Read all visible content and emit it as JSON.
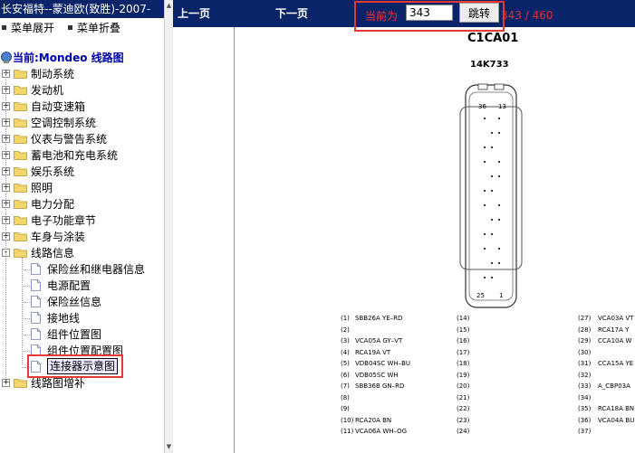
{
  "left_panel": {
    "title": "长安福特--蒙迪欧(致胜)-2007-",
    "expand_label": "菜单展开",
    "collapse_label": "菜单折叠",
    "current_label": "当前:Mondeo 线路图",
    "tree": [
      {
        "label": "制动系统",
        "type": "folder",
        "state": "+"
      },
      {
        "label": "发动机",
        "type": "folder",
        "state": "+"
      },
      {
        "label": "自动变速箱",
        "type": "folder",
        "state": "+"
      },
      {
        "label": "空调控制系统",
        "type": "folder",
        "state": "+"
      },
      {
        "label": "仪表与警告系统",
        "type": "folder",
        "state": "+"
      },
      {
        "label": "蓄电池和充电系统",
        "type": "folder",
        "state": "+"
      },
      {
        "label": "娱乐系统",
        "type": "folder",
        "state": "+"
      },
      {
        "label": "照明",
        "type": "folder",
        "state": "+"
      },
      {
        "label": "电力分配",
        "type": "folder",
        "state": "+"
      },
      {
        "label": "电子功能章节",
        "type": "folder",
        "state": "+"
      },
      {
        "label": "车身与涂装",
        "type": "folder",
        "state": "+"
      },
      {
        "label": "线路信息",
        "type": "folder",
        "state": "-"
      },
      {
        "label": "保险丝和继电器信息",
        "type": "doc"
      },
      {
        "label": "电源配置",
        "type": "doc"
      },
      {
        "label": "保险丝信息",
        "type": "doc"
      },
      {
        "label": "接地线",
        "type": "doc"
      },
      {
        "label": "组件位置图",
        "type": "doc"
      },
      {
        "label": "组件位置配置图",
        "type": "doc"
      },
      {
        "label": "连接器示意图",
        "type": "doc",
        "selected": true
      },
      {
        "label": "线路图增补",
        "type": "folder",
        "state": "+"
      }
    ]
  },
  "toolbar": {
    "prev_label": "上一页",
    "next_label": "下一页",
    "current_prefix": "当前为",
    "page_value": "343",
    "go_label": "跳转",
    "total_label": "343 / 460"
  },
  "document": {
    "connector_title": "C1CA01",
    "connector_id": "14K733",
    "pin_top_left": "36",
    "pin_top_right": "13",
    "pin_bottom_left": "25",
    "pin_bottom_right": "1",
    "col1": [
      {
        "n": "(1)",
        "w": "SBB26A YE–RD"
      },
      {
        "n": "(2)",
        "w": ""
      },
      {
        "n": "(3)",
        "w": "VCA05A GY–VT"
      },
      {
        "n": "(4)",
        "w": "RCA19A VT"
      },
      {
        "n": "(5)",
        "w": "VDB04SC WH–BU"
      },
      {
        "n": "(6)",
        "w": "VDB05SC WH"
      },
      {
        "n": "(7)",
        "w": "SBB36B GN–RD"
      },
      {
        "n": "(8)",
        "w": ""
      },
      {
        "n": "(9)",
        "w": ""
      },
      {
        "n": "(10)",
        "w": "RCA20A BN"
      },
      {
        "n": "(11)",
        "w": "VCA06A WH–OG"
      }
    ],
    "col2": [
      "(14)",
      "(15)",
      "(16)",
      "(17)",
      "(18)",
      "(19)",
      "(20)",
      "(21)",
      "(22)",
      "(23)",
      "(24)"
    ],
    "col3": [
      {
        "n": "(27)",
        "w": "VCA03A VT"
      },
      {
        "n": "(28)",
        "w": "RCA17A Y"
      },
      {
        "n": "(29)",
        "w": "CCA10A W"
      },
      {
        "n": "(30)",
        "w": ""
      },
      {
        "n": "(31)",
        "w": "CCA15A YE"
      },
      {
        "n": "(32)",
        "w": ""
      },
      {
        "n": "(33)",
        "w": "A_CBP03A"
      },
      {
        "n": "(34)",
        "w": ""
      },
      {
        "n": "(35)",
        "w": "RCA18A BN"
      },
      {
        "n": "(36)",
        "w": "VCA04A BU"
      },
      {
        "n": "(37)",
        "w": ""
      }
    ]
  },
  "colors": {
    "titlebar": "#0a246a",
    "highlight": "#e53935",
    "current_text": "#0000aa"
  }
}
